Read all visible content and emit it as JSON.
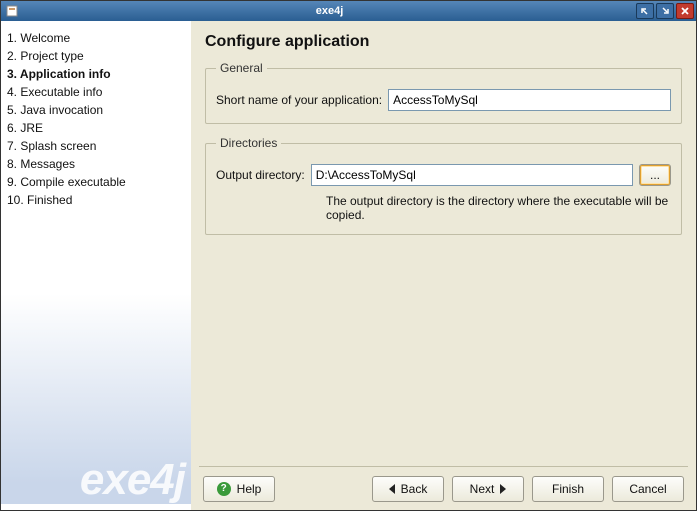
{
  "window": {
    "title": "exe4j"
  },
  "sidebar": {
    "brand": "exe4j",
    "items": [
      {
        "label": "1. Welcome"
      },
      {
        "label": "2. Project type"
      },
      {
        "label": "3. Application info",
        "current": true
      },
      {
        "label": "4. Executable info"
      },
      {
        "label": "5. Java invocation"
      },
      {
        "label": "6. JRE"
      },
      {
        "label": "7. Splash screen"
      },
      {
        "label": "8. Messages"
      },
      {
        "label": "9. Compile executable"
      },
      {
        "label": "10. Finished"
      }
    ]
  },
  "page": {
    "heading": "Configure application",
    "general": {
      "legend": "General",
      "short_name_label": "Short name of your application:",
      "short_name_value": "AccessToMySql"
    },
    "directories": {
      "legend": "Directories",
      "output_label": "Output directory:",
      "output_value": "D:\\AccessToMySql",
      "browse_icon": "...",
      "hint": "The output directory is the directory where the executable will be copied."
    }
  },
  "buttons": {
    "help": "Help",
    "back": "Back",
    "next": "Next",
    "finish": "Finish",
    "cancel": "Cancel"
  }
}
